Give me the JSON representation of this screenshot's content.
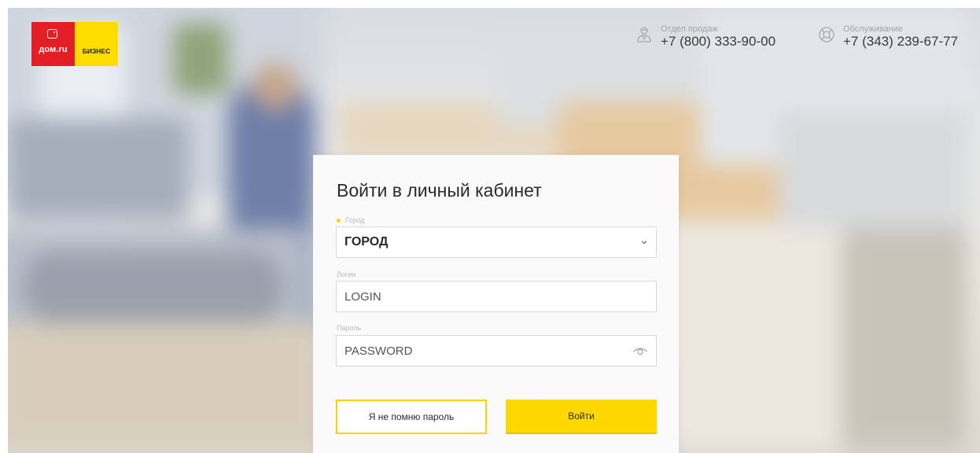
{
  "brand": {
    "name": "дом.ru",
    "segment": "БИЗНЕС",
    "red": "#e31e24",
    "yellow": "#ffdd00"
  },
  "contacts": [
    {
      "label": "Отдел продаж",
      "phone": "+7 (800) 333-90-00",
      "icon": "person-icon"
    },
    {
      "label": "Обслуживание",
      "phone": "+7 (343) 239-67-77",
      "icon": "lifebuoy-icon"
    }
  ],
  "login": {
    "title": "Войти в личный кабинет",
    "city": {
      "label": "Город",
      "value": "ГОРОД"
    },
    "username": {
      "label": "Логин",
      "placeholder": "LOGIN"
    },
    "password": {
      "label": "Пароль",
      "placeholder": "PASSWORD"
    },
    "forgot_button": "Я не помню пароль",
    "submit_button": "Войти",
    "accent": "#ffd800"
  }
}
